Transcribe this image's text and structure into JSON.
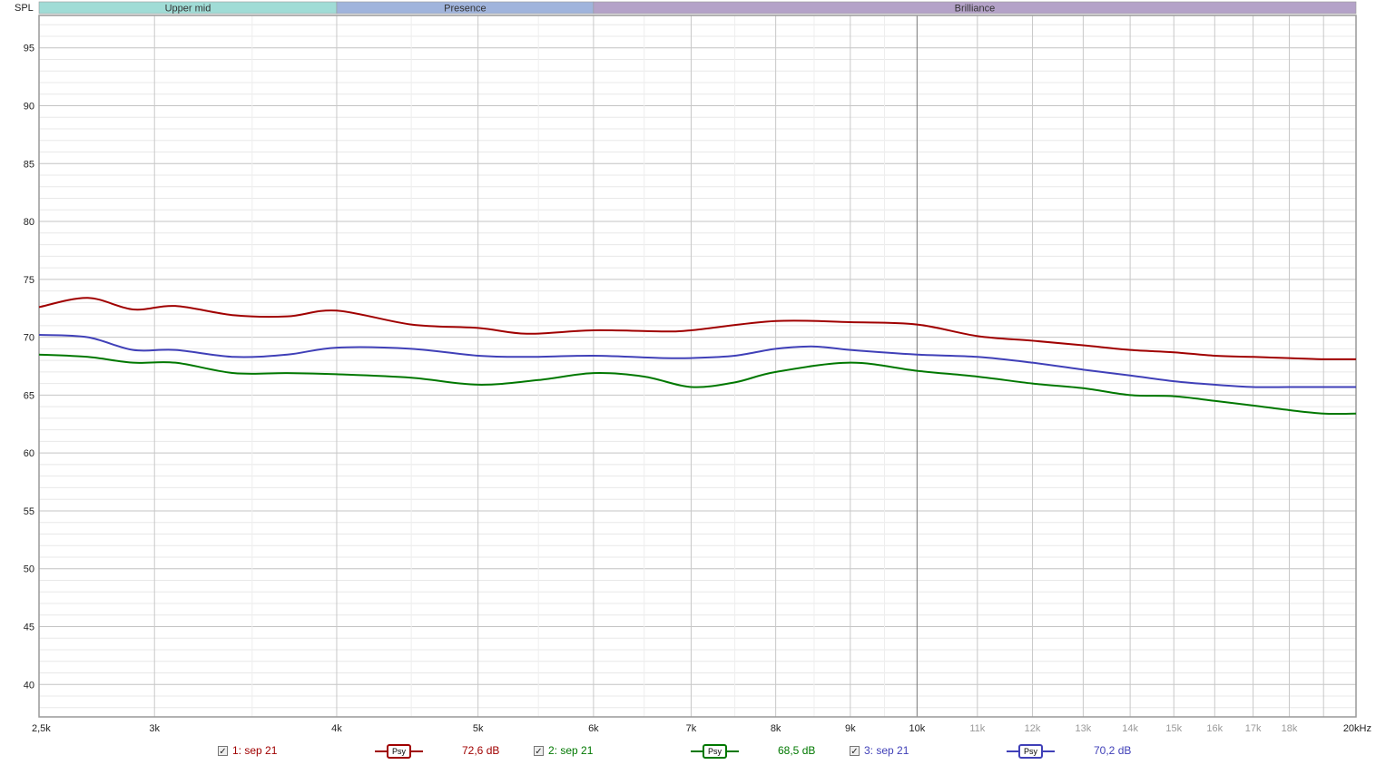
{
  "chart_data": {
    "type": "line",
    "ylabel": "SPL",
    "xunit": "Hz",
    "xscale": "log",
    "xlim": [
      2500,
      20000
    ],
    "ylim": [
      37.2,
      97.8
    ],
    "grid": true,
    "y_ticks": [
      40,
      45,
      50,
      55,
      60,
      65,
      70,
      75,
      80,
      85,
      90,
      95
    ],
    "y_tick_labels": [
      "40",
      "45",
      "50",
      "55",
      "60",
      "65",
      "70",
      "75",
      "80",
      "85",
      "90",
      "95"
    ],
    "x_ticks": [
      2500,
      3000,
      4000,
      5000,
      6000,
      7000,
      8000,
      9000,
      10000,
      11000,
      12000,
      13000,
      14000,
      15000,
      16000,
      17000,
      18000,
      20000
    ],
    "x_tick_labels": [
      "2,5k",
      "3k",
      "4k",
      "5k",
      "6k",
      "7k",
      "8k",
      "9k",
      "10k",
      "11k",
      "12k",
      "13k",
      "14k",
      "15k",
      "16k",
      "17k",
      "18k",
      "20kHz"
    ],
    "bands": [
      {
        "label": "Upper mid",
        "from": 2500,
        "to": 4000,
        "color": "#a0dcd6"
      },
      {
        "label": "Presence",
        "from": 4000,
        "to": 6000,
        "color": "#a0b4dc"
      },
      {
        "label": "Brilliance",
        "from": 6000,
        "to": 20000,
        "color": "#b4a2c8"
      }
    ],
    "series": [
      {
        "name": "1: sep 21",
        "color": "#a00000",
        "smoothing": "Psy",
        "level": "72,6 dB",
        "x": [
          2500,
          2700,
          2900,
          3100,
          3400,
          3700,
          4000,
          4500,
          5000,
          5400,
          6000,
          6700,
          7000,
          8000,
          9000,
          10000,
          11000,
          12000,
          13000,
          14000,
          15000,
          16000,
          17000,
          18000,
          19000,
          20000
        ],
        "y": [
          72.6,
          73.4,
          72.4,
          72.7,
          71.9,
          71.8,
          72.3,
          71.1,
          70.8,
          70.3,
          70.6,
          70.5,
          70.6,
          71.4,
          71.3,
          71.1,
          70.1,
          69.7,
          69.3,
          68.9,
          68.7,
          68.4,
          68.3,
          68.2,
          68.1,
          68.1
        ]
      },
      {
        "name": "2: sep 21",
        "color": "#007800",
        "smoothing": "Psy",
        "level": "68,5 dB",
        "x": [
          2500,
          2700,
          2900,
          3100,
          3400,
          3700,
          4000,
          4500,
          5000,
          5500,
          6000,
          6500,
          7000,
          7500,
          8000,
          9000,
          10000,
          11000,
          12000,
          13000,
          14000,
          15000,
          16000,
          17000,
          18000,
          19000,
          20000
        ],
        "y": [
          68.5,
          68.3,
          67.8,
          67.8,
          66.9,
          66.9,
          66.8,
          66.5,
          65.9,
          66.3,
          66.9,
          66.6,
          65.7,
          66.1,
          67.0,
          67.8,
          67.1,
          66.6,
          66.0,
          65.6,
          65.0,
          64.9,
          64.5,
          64.1,
          63.7,
          63.4,
          63.4
        ]
      },
      {
        "name": "3: sep 21",
        "color": "#4040b8",
        "smoothing": "Psy",
        "level": "70,2 dB",
        "x": [
          2500,
          2700,
          2900,
          3100,
          3400,
          3700,
          4000,
          4500,
          5000,
          5400,
          6000,
          6700,
          7000,
          7500,
          8000,
          8500,
          9000,
          10000,
          11000,
          12000,
          13000,
          14000,
          15000,
          16000,
          17000,
          18000,
          20000
        ],
        "y": [
          70.2,
          70.0,
          68.9,
          68.9,
          68.3,
          68.5,
          69.1,
          69.0,
          68.4,
          68.3,
          68.4,
          68.2,
          68.2,
          68.4,
          69.0,
          69.2,
          68.9,
          68.5,
          68.3,
          67.8,
          67.2,
          66.7,
          66.2,
          65.9,
          65.7,
          65.7,
          65.7
        ]
      }
    ]
  }
}
